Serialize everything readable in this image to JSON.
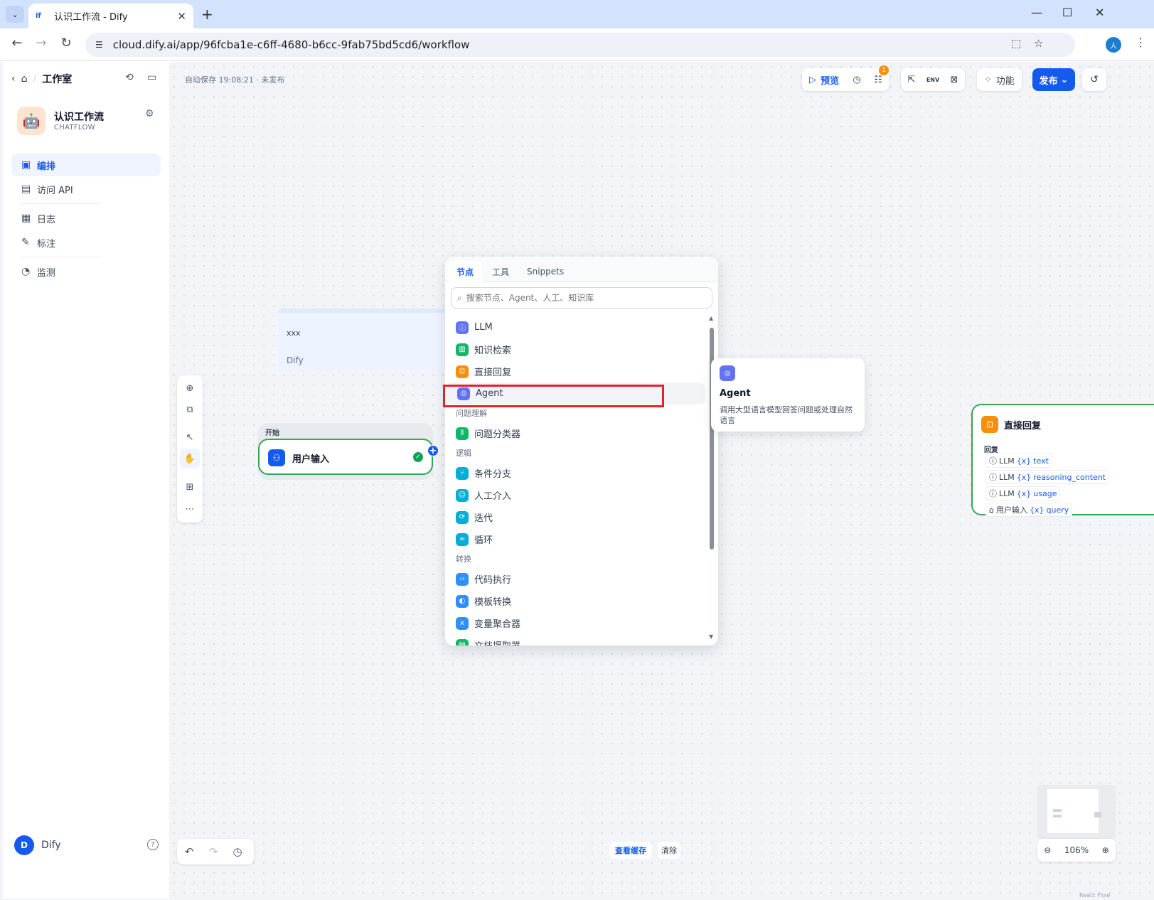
{
  "browser": {
    "tab_title": "认识工作流 - Dify",
    "tab_favicon": "if",
    "url": "cloud.dify.ai/app/96fcba1e-c6ff-4680-b6cc-9fab75bd5cd6/workflow",
    "profile_initial": "人"
  },
  "sidebar": {
    "breadcrumb": "工作室",
    "app_name": "认识工作流",
    "app_type": "CHATFLOW",
    "nav": [
      {
        "label": "编排",
        "icon": "layout-icon",
        "active": true
      },
      {
        "label": "访问 API",
        "icon": "terminal-icon",
        "active": false
      },
      {
        "label": "日志",
        "icon": "document-icon",
        "active": false
      },
      {
        "label": "标注",
        "icon": "annotation-icon",
        "active": false
      },
      {
        "label": "监测",
        "icon": "gauge-icon",
        "active": false
      }
    ],
    "user_initial": "D",
    "user_name": "Dify"
  },
  "toolbar": {
    "autosave": "自动保存 19:08:21 · 未发布",
    "preview": "预览",
    "checklist_badge": "1",
    "features": "功能",
    "publish": "发布"
  },
  "canvas": {
    "note": {
      "line1": "xxx",
      "line2": "Dify"
    },
    "start_group_label": "开始",
    "start_node": "用户输入",
    "reply_node": {
      "title": "直接回复",
      "section": "回复",
      "vars": [
        {
          "source": "LLM",
          "var": "text"
        },
        {
          "source": "LLM",
          "var": "reasoning_content"
        },
        {
          "source": "LLM",
          "var": "usage"
        },
        {
          "source": "用户输入",
          "var": "query"
        }
      ]
    }
  },
  "popup": {
    "tabs": [
      "节点",
      "工具",
      "Snippets"
    ],
    "search_placeholder": "搜索节点、Agent、人工、知识库",
    "items_top": [
      {
        "label": "LLM",
        "color": "#6172f3"
      },
      {
        "label": "知识检索",
        "color": "#12b76a"
      },
      {
        "label": "直接回复",
        "color": "#f79009"
      },
      {
        "label": "Agent",
        "color": "#6172f3"
      }
    ],
    "group1": "问题理解",
    "items_g1": [
      {
        "label": "问题分类器",
        "color": "#12b76a"
      }
    ],
    "group2": "逻辑",
    "items_g2": [
      {
        "label": "条件分支",
        "color": "#06aed4"
      },
      {
        "label": "人工介入",
        "color": "#06aed4"
      },
      {
        "label": "迭代",
        "color": "#06aed4"
      },
      {
        "label": "循环",
        "color": "#06aed4"
      }
    ],
    "group3": "转换",
    "items_g3": [
      {
        "label": "代码执行",
        "color": "#2e90fa"
      },
      {
        "label": "模板转换",
        "color": "#2e90fa"
      },
      {
        "label": "变量聚合器",
        "color": "#2e90fa"
      },
      {
        "label": "文档提取器",
        "color": "#12b76a"
      }
    ]
  },
  "tooltip": {
    "title": "Agent",
    "desc": "调用大型语言模型回答问题或处理自然语言"
  },
  "bottom": {
    "view_cache": "查看缓存",
    "clear": "清除",
    "zoom": "106%",
    "react_flow": "React Flow"
  }
}
